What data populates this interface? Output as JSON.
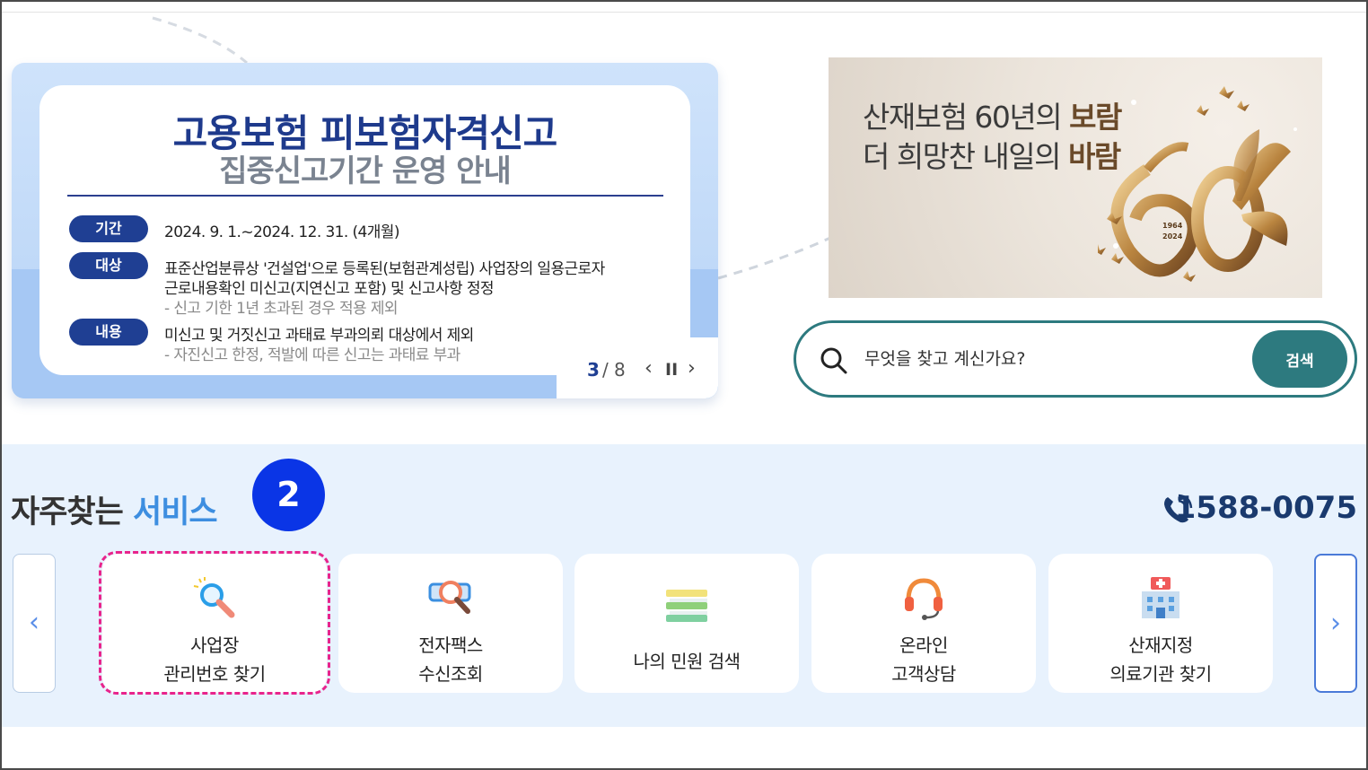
{
  "banner_left": {
    "title_line1": "고용보험 피보험자격신고",
    "title_line2": "집중신고기간 운영 안내",
    "rows": [
      {
        "label": "기간",
        "lines": [
          "2024. 9. 1.~2024. 12. 31. (4개월)"
        ]
      },
      {
        "label": "대상",
        "lines": [
          "표준산업분류상 '건설업'으로 등록된(보험관계성립) 사업장의 일용근로자",
          "근로내용확인 미신고(지연신고 포함) 및 신고사항 정정"
        ],
        "sub": "- 신고 기한 1년 초과된 경우 적용 제외"
      },
      {
        "label": "내용",
        "lines": [
          "미신고 및 거짓신고 과태료 부과의뢰 대상에서 제외"
        ],
        "sub": "- 자진신고 한정, 적발에 따른 신고는 과태료 부과"
      }
    ],
    "pager": {
      "current": "3",
      "separator": "/",
      "total": "8",
      "prev": "‹",
      "pause": "II",
      "next": "›"
    }
  },
  "banner_right": {
    "line1_normal": "산재보험 60년의 ",
    "line1_bold": "보람",
    "line2_normal": "더 희망찬 내일의 ",
    "line2_bold": "바람",
    "year_start": "1964",
    "year_end": "2024"
  },
  "search": {
    "placeholder": "무엇을 찾고 계신가요?",
    "button": "검색"
  },
  "services": {
    "title_normal": "자주찾는 ",
    "title_accent": "서비스",
    "badge": "2",
    "phone": "1588-0075",
    "prev": "‹",
    "next": "›",
    "cards": [
      {
        "line1": "사업장",
        "line2": "관리번호 찾기",
        "icon": "magnifier-icon"
      },
      {
        "line1": "전자팩스",
        "line2": "수신조회",
        "icon": "fax-search-icon"
      },
      {
        "single": "나의 민원 검색",
        "icon": "books-icon"
      },
      {
        "line1": "온라인",
        "line2": "고객상담",
        "icon": "headset-icon"
      },
      {
        "line1": "산재지정",
        "line2": "의료기관 찾기",
        "icon": "hospital-icon"
      }
    ]
  },
  "colors": {
    "navy": "#1f3f93",
    "teal": "#2d7a7f",
    "accent_blue": "#3d8ee0",
    "badge_blue": "#0a35e6",
    "highlight_pink": "#e8248c"
  }
}
